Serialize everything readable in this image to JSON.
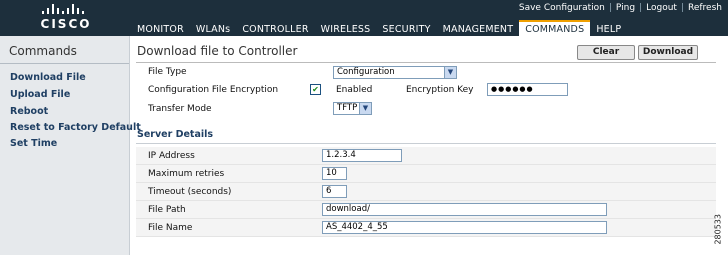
{
  "header": {
    "logo_text": "CISCO",
    "util_links": [
      "Save Configuration",
      "Ping",
      "Logout",
      "Refresh"
    ],
    "nav": [
      "MONITOR",
      "WLANs",
      "CONTROLLER",
      "WIRELESS",
      "SECURITY",
      "MANAGEMENT",
      "COMMANDS",
      "HELP"
    ],
    "active_nav": "COMMANDS"
  },
  "sidebar": {
    "title": "Commands",
    "items": [
      {
        "label": "Download File"
      },
      {
        "label": "Upload File"
      },
      {
        "label": "Reboot"
      },
      {
        "label": "Reset to Factory Default"
      },
      {
        "label": "Set Time"
      }
    ]
  },
  "main": {
    "title": "Download file to Controller",
    "clear_label": "Clear",
    "download_label": "Download",
    "file_type_label": "File Type",
    "file_type_value": "Configuration",
    "encryption_label": "Configuration File Encryption",
    "enabled_label": "Enabled",
    "encryption_checked": true,
    "encryption_key_label": "Encryption Key",
    "encryption_key_value": "●●●●●●",
    "transfer_mode_label": "Transfer Mode",
    "transfer_mode_value": "TFTP",
    "server_details_title": "Server Details",
    "fields": [
      {
        "label": "IP Address",
        "value": "1.2.3.4"
      },
      {
        "label": "Maximum retries",
        "value": "10"
      },
      {
        "label": "Timeout (seconds)",
        "value": "6"
      },
      {
        "label": "File Path",
        "value": "download/"
      },
      {
        "label": "File Name",
        "value": "AS_4402_4_55"
      }
    ]
  },
  "side_id": "280533",
  "colors": {
    "header_bg": "#1d2f3c",
    "sidebar_bg": "#e6e9ec",
    "link": "#1f3f63",
    "active_tab_accent": "#f0a000"
  }
}
